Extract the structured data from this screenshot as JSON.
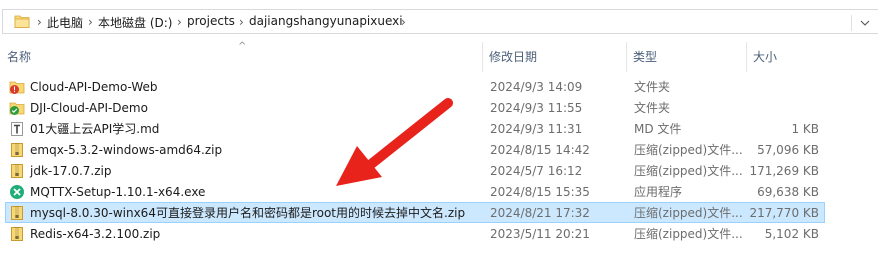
{
  "address": {
    "crumbs": [
      "此电脑",
      "本地磁盘 (D:)",
      "projects",
      "dajiangshangyunapixuexi"
    ],
    "separator": "›"
  },
  "columns": {
    "name": "名称",
    "date": "修改日期",
    "type": "类型",
    "size": "大小",
    "sort_indicator": "^"
  },
  "files": [
    {
      "name": "Cloud-API-Demo-Web",
      "date": "2024/9/3 14:09",
      "type": "文件夹",
      "size": "",
      "icon": "folder-error-icon",
      "selected": false
    },
    {
      "name": "DJI-Cloud-API-Demo",
      "date": "2024/9/3 11:55",
      "type": "文件夹",
      "size": "",
      "icon": "folder-synced-icon",
      "selected": false
    },
    {
      "name": "01大疆上云API学习.md",
      "date": "2024/9/3 11:31",
      "type": "MD 文件",
      "size": "1 KB",
      "icon": "text-file-icon",
      "selected": false
    },
    {
      "name": "emqx-5.3.2-windows-amd64.zip",
      "date": "2024/8/15 14:42",
      "type": "压缩(zipped)文件...",
      "size": "57,096 KB",
      "icon": "zip-icon",
      "selected": false
    },
    {
      "name": "jdk-17.0.7.zip",
      "date": "2024/5/7 16:12",
      "type": "压缩(zipped)文件...",
      "size": "171,269 KB",
      "icon": "zip-icon",
      "selected": false
    },
    {
      "name": "MQTTX-Setup-1.10.1-x64.exe",
      "date": "2024/8/15 15:35",
      "type": "应用程序",
      "size": "69,638 KB",
      "icon": "mqttx-app-icon",
      "selected": false
    },
    {
      "name": "mysql-8.0.30-winx64可直接登录用户名和密码都是root用的时候去掉中文名.zip",
      "date": "2024/8/21 17:32",
      "type": "压缩(zipped)文件...",
      "size": "217,770 KB",
      "icon": "zip-icon",
      "selected": true
    },
    {
      "name": "Redis-x64-3.2.100.zip",
      "date": "2023/5/11 20:21",
      "type": "压缩(zipped)文件...",
      "size": "5,102 KB",
      "icon": "zip-icon",
      "selected": false
    }
  ],
  "colors": {
    "selection_bg": "#cce8ff",
    "selection_border": "#99d1ff",
    "folder": "#f8d775",
    "annotation_arrow": "#e8231c"
  }
}
